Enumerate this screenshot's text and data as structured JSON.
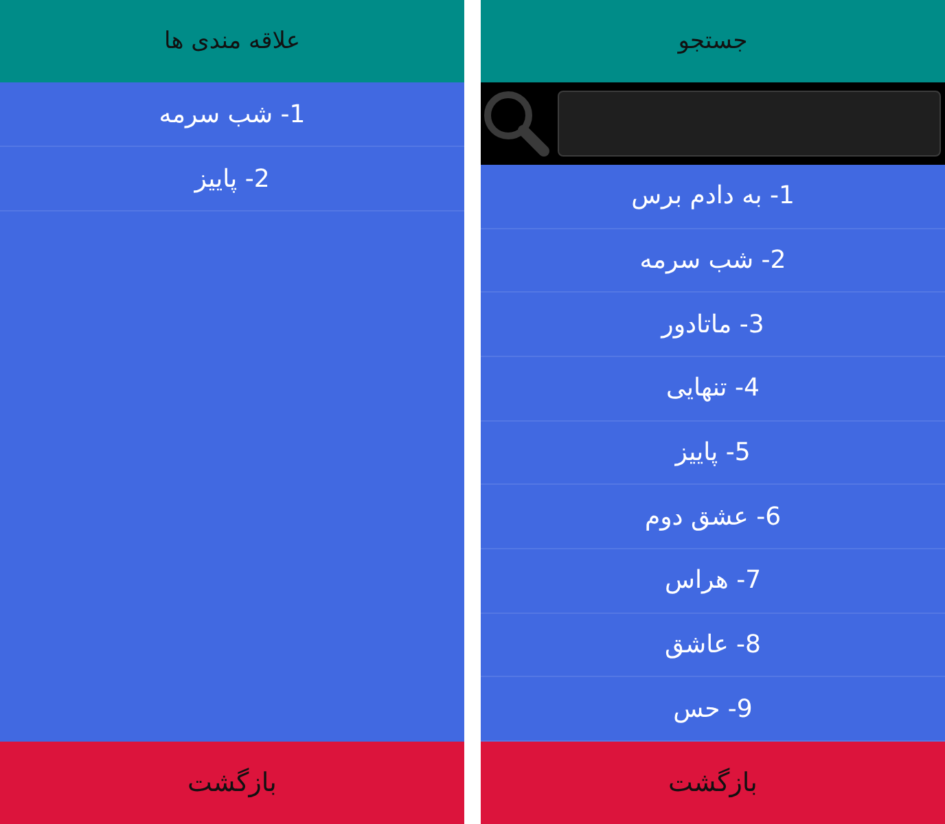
{
  "screens": [
    {
      "kind": "search",
      "title": "جستجو",
      "items": [
        "1- به دادم برس",
        "2- شب سرمه",
        "3- ماتادور",
        "4- تنهایی",
        "5- پاییز",
        "6- عشق دوم",
        "7- هراس",
        "8- عاشق",
        "9- حس"
      ],
      "back_button": "بازگشت"
    },
    {
      "kind": "favorites",
      "title": "علاقه مندی ها",
      "items": [
        "1- شب سرمه",
        "2- پاییز"
      ],
      "back_button": "بازگشت"
    }
  ]
}
